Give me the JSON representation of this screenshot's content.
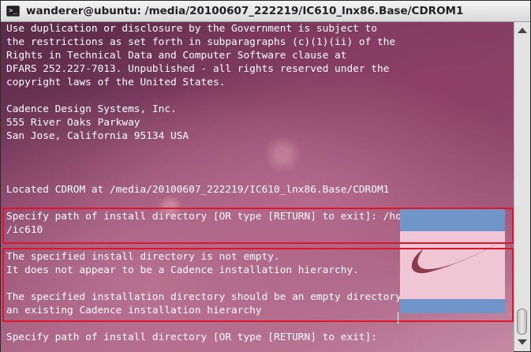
{
  "window": {
    "title": "wanderer@ubuntu: /media/20100607_222219/IC610_lnx86.Base/CDROM1"
  },
  "terminal": {
    "lines": [
      "Use duplication or disclosure by the Government is subject to",
      "the restrictions as set forth in subparagraphs (c)(1)(ii) of the",
      "Rights in Technical Data and Computer Software clause at",
      "DFARS 252.227-7013. Unpublished - all rights reserved under the",
      "copyright laws of the United States.",
      "",
      "Cadence Design Systems, Inc.",
      "555 River Oaks Parkway",
      "San Jose, California 95134 USA",
      "",
      "",
      "",
      "Located CDROM at /media/20100607_222219/IC610_lnx86.Base/CDROM1",
      "",
      "Specify path of install directory [OR type [RETURN] to exit]: /home/wanderer/eda",
      "/ic610",
      "",
      "The specified install directory is not empty.",
      "It does not appear to be a Cadence installation hierarchy.",
      "",
      "The specified installation directory should be an empty directory or",
      "an existing Cadence installation hierarchy",
      "",
      "Specify path of install directory [OR type [RETURN] to exit]: "
    ]
  },
  "overlay": {
    "logo": "nike-swoosh-icon",
    "colors": {
      "blue": "#6f95c9",
      "pink": "#f1c6d4",
      "swoosh": "#8a3a4a"
    }
  },
  "annotation": {
    "color": "#e0142a"
  },
  "icons": {
    "terminal": "terminal-icon",
    "scroll_up": "scroll-up-arrow",
    "scroll_down": "scroll-down-arrow"
  }
}
